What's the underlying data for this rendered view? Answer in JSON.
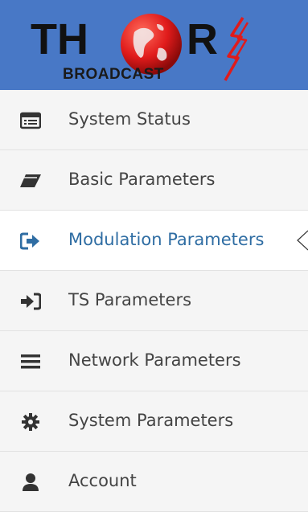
{
  "brand": {
    "logo_top": "THOR",
    "logo_bottom": "BROADCAST",
    "header_color": "#4878c6"
  },
  "menu": {
    "active_color": "#2f6da3",
    "items": [
      {
        "label": "System Status",
        "icon": "list-icon",
        "active": false
      },
      {
        "label": "Basic Parameters",
        "icon": "eraser-icon",
        "active": false
      },
      {
        "label": "Modulation Parameters",
        "icon": "sign-out-icon",
        "active": true
      },
      {
        "label": "TS Parameters",
        "icon": "sign-in-icon",
        "active": false
      },
      {
        "label": "Network Parameters",
        "icon": "bars-icon",
        "active": false
      },
      {
        "label": "System Parameters",
        "icon": "gear-icon",
        "active": false
      },
      {
        "label": "Account",
        "icon": "user-icon",
        "active": false
      }
    ]
  }
}
